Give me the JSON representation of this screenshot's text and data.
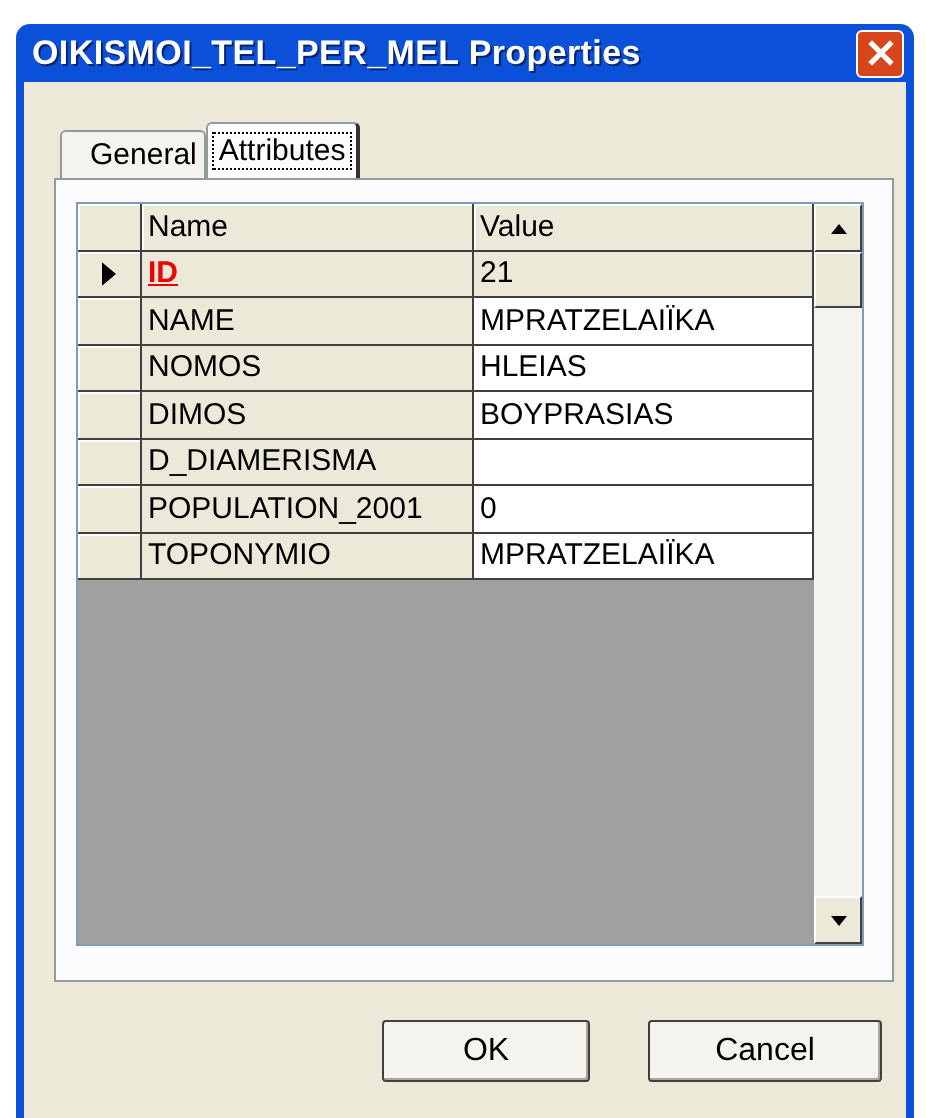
{
  "window": {
    "title": "OIKISMOI_TEL_PER_MEL Properties"
  },
  "tabs": [
    {
      "label": "General",
      "selected": false
    },
    {
      "label": "Attributes",
      "selected": true
    }
  ],
  "table": {
    "columns": [
      "Name",
      "Value"
    ],
    "rows": [
      {
        "name": "ID",
        "value": "21",
        "selected": true,
        "key": true
      },
      {
        "name": "NAME",
        "value": "MPRATZELAIÏKA",
        "selected": false,
        "key": false
      },
      {
        "name": "NOMOS",
        "value": "HLEIAS",
        "selected": false,
        "key": false
      },
      {
        "name": "DIMOS",
        "value": "BOYPRASIAS",
        "selected": false,
        "key": false
      },
      {
        "name": "D_DIAMERISMA",
        "value": "",
        "selected": false,
        "key": false
      },
      {
        "name": "POPULATION_2001",
        "value": "0",
        "selected": false,
        "key": false
      },
      {
        "name": "TOPONYMIO",
        "value": "MPRATZELAIÏKA",
        "selected": false,
        "key": false
      }
    ]
  },
  "buttons": [
    "OK",
    "Cancel"
  ]
}
